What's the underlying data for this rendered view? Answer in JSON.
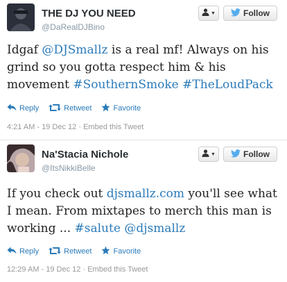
{
  "tweets": [
    {
      "name": "THE DJ YOU NEED",
      "handle": "@DaRealDJBino",
      "follow_label": "Follow",
      "text_lines": [
        [
          {
            "t": "Idgaf "
          },
          {
            "t": "@DJSmallz",
            "link": true
          },
          {
            "t": " is a real mf! Always on his"
          }
        ],
        [
          {
            "t": "grind so you gotta respect him & his"
          }
        ],
        [
          {
            "t": "movement "
          },
          {
            "t": "#SouthernSmoke",
            "link": true
          },
          {
            "t": " "
          },
          {
            "t": "#TheLoudPack",
            "link": true
          }
        ]
      ],
      "reply_label": "Reply",
      "retweet_label": "Retweet",
      "favorite_label": "Favorite",
      "timestamp": "4:21 AM - 19 Dec 12",
      "embed_label": "Embed this Tweet"
    },
    {
      "name": "Na'Stacia Nichole",
      "handle": "@ItsNikkiBelle",
      "follow_label": "Follow",
      "text_lines": [
        [
          {
            "t": "If you check out "
          },
          {
            "t": "djsmallz.com",
            "link": true
          },
          {
            "t": " you'll see what"
          }
        ],
        [
          {
            "t": "I mean. From mixtapes to merch this man is"
          }
        ],
        [
          {
            "t": "working ... "
          },
          {
            "t": "#salute",
            "link": true
          },
          {
            "t": " "
          },
          {
            "t": "@djsmallz",
            "link": true
          }
        ]
      ],
      "reply_label": "Reply",
      "retweet_label": "Retweet",
      "favorite_label": "Favorite",
      "timestamp": "12:29 AM - 19 Dec 12",
      "embed_label": "Embed this Tweet"
    }
  ],
  "colors": {
    "link": "#2b7bb9",
    "twitter_bird": "#55acee",
    "meta_text": "#999999"
  },
  "icons": {
    "reply": "reply-arrow-icon",
    "retweet": "retweet-icon",
    "favorite": "star-icon",
    "follow": "twitter-bird-icon",
    "user_menu": "user-silhouette-icon"
  }
}
